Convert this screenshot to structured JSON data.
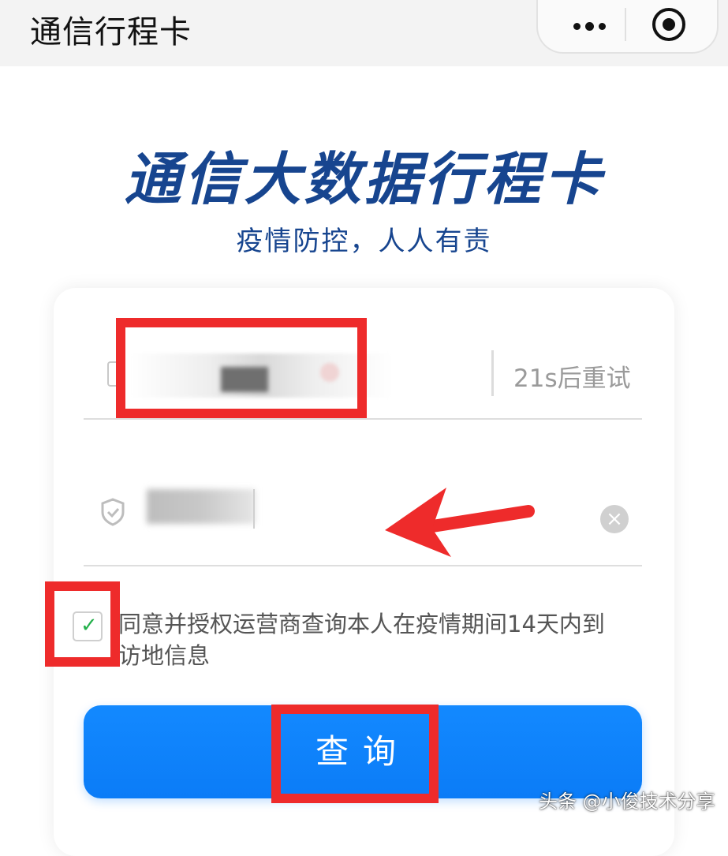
{
  "topbar": {
    "title": "通信行程卡",
    "more_icon": "more-dots-icon",
    "close_icon": "target-close-icon"
  },
  "hero": {
    "title": "通信大数据行程卡",
    "subtitle": "疫情防控，人人有责"
  },
  "form": {
    "phone_icon": "phone-icon",
    "resend_label": "21s后重试",
    "code_icon": "shield-check-icon",
    "clear_icon": "clear-circle-icon",
    "agree_checked": true,
    "agree_text": "同意并授权运营商查询本人在疫情期间14天内到访地信息",
    "query_label": "查询"
  },
  "watermark": "头条 @小俊技术分享",
  "colors": {
    "title_blue": "#17458f",
    "button_blue": "#0b7cf7",
    "annotation_red": "#ee2b2b",
    "check_green": "#24b04b"
  }
}
